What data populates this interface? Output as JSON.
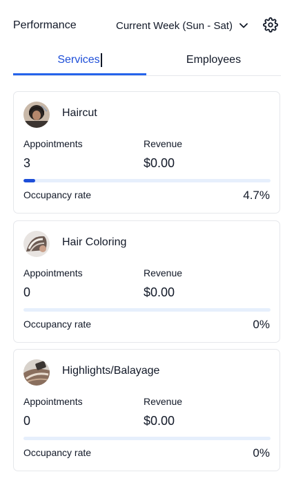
{
  "header": {
    "title": "Performance",
    "period_label": "Current Week (Sun - Sat)",
    "period_icon": "chevron-down-icon",
    "settings_icon": "gear-icon"
  },
  "tabs": [
    {
      "label": "Services",
      "active": true
    },
    {
      "label": "Employees",
      "active": false
    }
  ],
  "labels": {
    "appointments": "Appointments",
    "revenue": "Revenue",
    "occupancy": "Occupancy rate"
  },
  "services": [
    {
      "name": "Haircut",
      "appointments": "3",
      "revenue": "$0.00",
      "occupancy": "4.7%",
      "occupancy_fraction": 0.047,
      "thumb": "haircut-photo"
    },
    {
      "name": "Hair Coloring",
      "appointments": "0",
      "revenue": "$0.00",
      "occupancy": "0%",
      "occupancy_fraction": 0,
      "thumb": "hair-coloring-photo"
    },
    {
      "name": "Highlights/Balayage",
      "appointments": "0",
      "revenue": "$0.00",
      "occupancy": "0%",
      "occupancy_fraction": 0,
      "thumb": "highlights-photo"
    }
  ],
  "colors": {
    "accent": "#2563eb",
    "accent_dark": "#1d4ed8",
    "bar_track": "#e6effc",
    "border": "#e5e7eb"
  }
}
